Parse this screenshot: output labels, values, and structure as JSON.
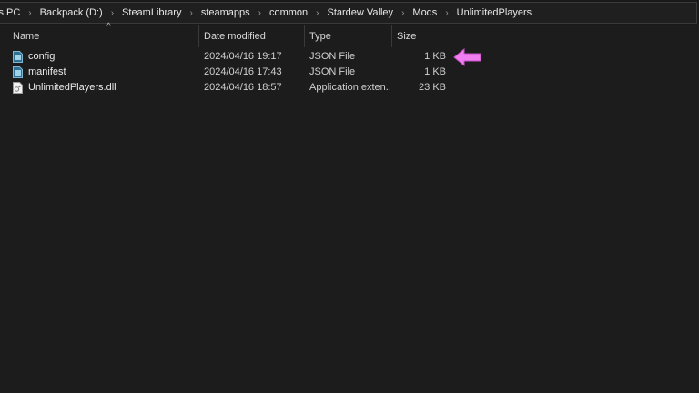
{
  "breadcrumb": {
    "items": [
      "is PC",
      "Backpack (D:)",
      "SteamLibrary",
      "steamapps",
      "common",
      "Stardew Valley",
      "Mods",
      "UnlimitedPlayers"
    ],
    "separator": "›"
  },
  "columns": {
    "name": "Name",
    "date_modified": "Date modified",
    "type": "Type",
    "size": "Size",
    "sort_indicator": "^"
  },
  "files": [
    {
      "name": "config",
      "date": "2024/04/16 19:17",
      "type": "JSON File",
      "size": "1 KB",
      "icon": "json-file-icon"
    },
    {
      "name": "manifest",
      "date": "2024/04/16 17:43",
      "type": "JSON File",
      "size": "1 KB",
      "icon": "json-file-icon"
    },
    {
      "name": "UnlimitedPlayers.dll",
      "date": "2024/04/16 18:57",
      "type": "Application exten...",
      "size": "23 KB",
      "icon": "dll-file-icon"
    }
  ],
  "annotation": {
    "icon": "arrow-left-icon",
    "color": "#f07ef0"
  },
  "colors": {
    "background": "#1c1c1c",
    "text": "#e6e6e6",
    "accent_arrow": "#f07ef0"
  }
}
